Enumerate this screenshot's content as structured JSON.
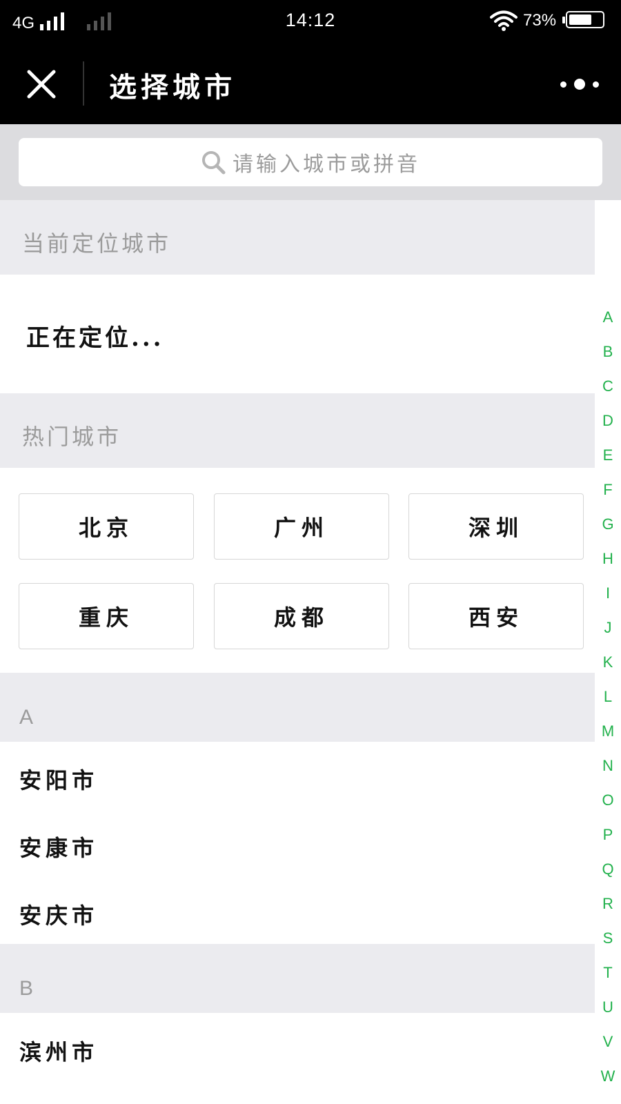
{
  "status_bar": {
    "network": "4G",
    "time": "14:12",
    "battery_percent": "73%",
    "battery_level": 0.73
  },
  "header": {
    "title": "选择城市",
    "close_icon": "close-icon",
    "more_icon": "more-icon"
  },
  "search": {
    "placeholder": "请输入城市或拼音",
    "icon": "search-icon"
  },
  "current_location": {
    "heading": "当前定位城市",
    "status": "正在定位..."
  },
  "hot_cities": {
    "heading": "热门城市",
    "items": [
      "北京",
      "广州",
      "深圳",
      "重庆",
      "成都",
      "西安"
    ]
  },
  "groups": [
    {
      "letter": "A",
      "cities": [
        "安阳市",
        "安康市",
        "安庆市"
      ]
    },
    {
      "letter": "B",
      "cities": [
        "滨州市"
      ]
    }
  ],
  "index_letters": [
    "A",
    "B",
    "C",
    "D",
    "E",
    "F",
    "G",
    "H",
    "I",
    "J",
    "K",
    "L",
    "M",
    "N",
    "O",
    "P",
    "Q",
    "R",
    "S",
    "T",
    "U",
    "V",
    "W"
  ],
  "colors": {
    "index_accent": "#22b14c",
    "section_bg": "#ebebef",
    "search_bg": "#dcdcdf",
    "header_bg": "#000000"
  }
}
